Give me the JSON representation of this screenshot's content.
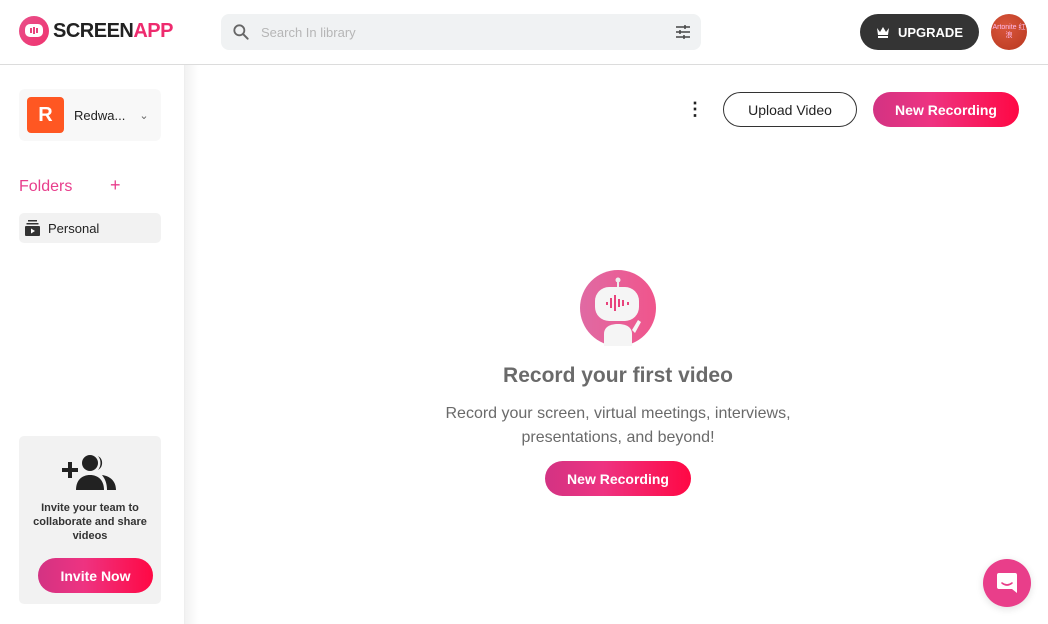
{
  "header": {
    "logo_primary": "SCREEN",
    "logo_accent": "APP",
    "search_placeholder": "Search In library",
    "upgrade_label": "UPGRADE",
    "avatar_text": "Artonite 红浪"
  },
  "sidebar": {
    "workspace": {
      "initial": "R",
      "name": "Redwa..."
    },
    "folders_title": "Folders",
    "folders_add": "+",
    "folders": [
      {
        "label": "Personal"
      }
    ],
    "invite": {
      "text": "Invite your team to collaborate and share videos",
      "button_label": "Invite Now"
    }
  },
  "toolbar": {
    "more_label": "⋮",
    "upload_label": "Upload Video",
    "new_recording_label": "New Recording"
  },
  "empty_state": {
    "title": "Record your first video",
    "description": "Record your screen, virtual meetings, interviews, presentations, and beyond!",
    "button_label": "New Recording"
  },
  "colors": {
    "brand_pink": "#e83e8c",
    "gradient_start": "#d33383",
    "gradient_end": "#ff0844",
    "workspace_badge": "#ff5722",
    "upgrade_bg": "#343434"
  }
}
